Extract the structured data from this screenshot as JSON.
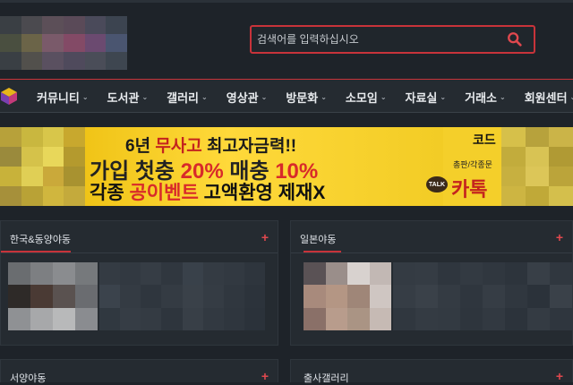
{
  "header": {
    "search": {
      "placeholder": "검색어를 입력하십시오"
    }
  },
  "nav": {
    "items": [
      {
        "label": "커뮤니티"
      },
      {
        "label": "도서관"
      },
      {
        "label": "갤러리"
      },
      {
        "label": "영상관"
      },
      {
        "label": "방문화"
      },
      {
        "label": "소모임"
      },
      {
        "label": "자료실"
      },
      {
        "label": "거래소"
      },
      {
        "label": "회원센터"
      }
    ]
  },
  "banner": {
    "line1_prefix": "6년 ",
    "line1_accent": "무사고",
    "line1_suffix": " 최고자금력!!",
    "line2_a": "가입 첫충 ",
    "line2_b": "20%",
    "line2_c": " 매충 ",
    "line2_d": "10%",
    "line3_a": "각종 ",
    "line3_b": "공이벤트",
    "line3_c": " 고액환영 제재X",
    "talk_badge": "TALK",
    "right_code_label": "코드",
    "right_small": "총판/각종문",
    "right_kakao": "카톡"
  },
  "panels": [
    {
      "title": "한국&동양야동",
      "plus": "+"
    },
    {
      "title": "일본야동",
      "plus": "+"
    },
    {
      "title": "서양야동",
      "plus": "+"
    },
    {
      "title": "출사갤러리",
      "plus": "+"
    }
  ],
  "colors": {
    "accent": "#c8333a",
    "background": "#1e2329",
    "panel": "#252b31",
    "banner_yellow": "#f2cc25"
  },
  "icons": {
    "search": "search-icon",
    "chevron": "chevron-down-icon",
    "plus": "plus-icon",
    "site_mark": "cube-logo-icon"
  }
}
